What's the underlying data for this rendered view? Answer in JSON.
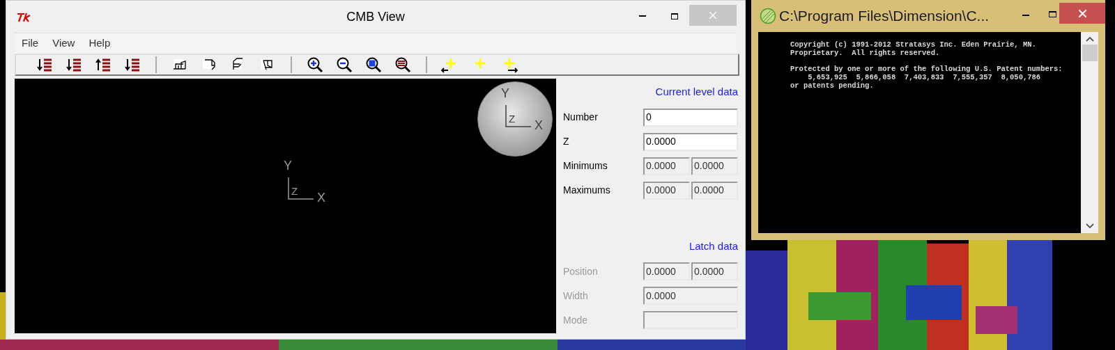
{
  "cmb_window": {
    "title": "CMB View",
    "menu": [
      "File",
      "View",
      "Help"
    ],
    "viewport": {
      "axis_labels": [
        "Y",
        "Z",
        "X"
      ],
      "ball_labels": [
        "Y",
        "Z",
        "X"
      ]
    },
    "current_level": {
      "heading": "Current level data",
      "fields": [
        {
          "label": "Number",
          "values": [
            "0"
          ],
          "editable": true,
          "disabled": false
        },
        {
          "label": "Z",
          "values": [
            "0.0000"
          ],
          "editable": true,
          "disabled": false
        },
        {
          "label": "Minimums",
          "values": [
            "0.0000",
            "0.0000"
          ],
          "editable": false,
          "disabled": false
        },
        {
          "label": "Maximums",
          "values": [
            "0.0000",
            "0.0000"
          ],
          "editable": false,
          "disabled": false
        }
      ]
    },
    "latch": {
      "heading": "Latch data",
      "fields": [
        {
          "label": "Position",
          "values": [
            "0.0000",
            "0.0000"
          ],
          "editable": false,
          "disabled": true
        },
        {
          "label": "Width",
          "values": [
            "0.0000"
          ],
          "editable": false,
          "disabled": true
        },
        {
          "label": "Mode",
          "editable": false,
          "disabled": true
        }
      ]
    }
  },
  "console_window": {
    "title": "C:\\Program Files\\Dimension\\C...",
    "paragraphs": [
      [
        "Copyright (c) 1991-2012 Stratasys Inc. Eden Prairie, MN.",
        "Proprietary.  All rights reserved."
      ],
      [
        "Protected by one or more of the following U.S. Patent numbers:",
        "    5,653,925  5,866,058  7,403,833  7,555,357  8,050,786",
        "or patents pending."
      ]
    ]
  }
}
